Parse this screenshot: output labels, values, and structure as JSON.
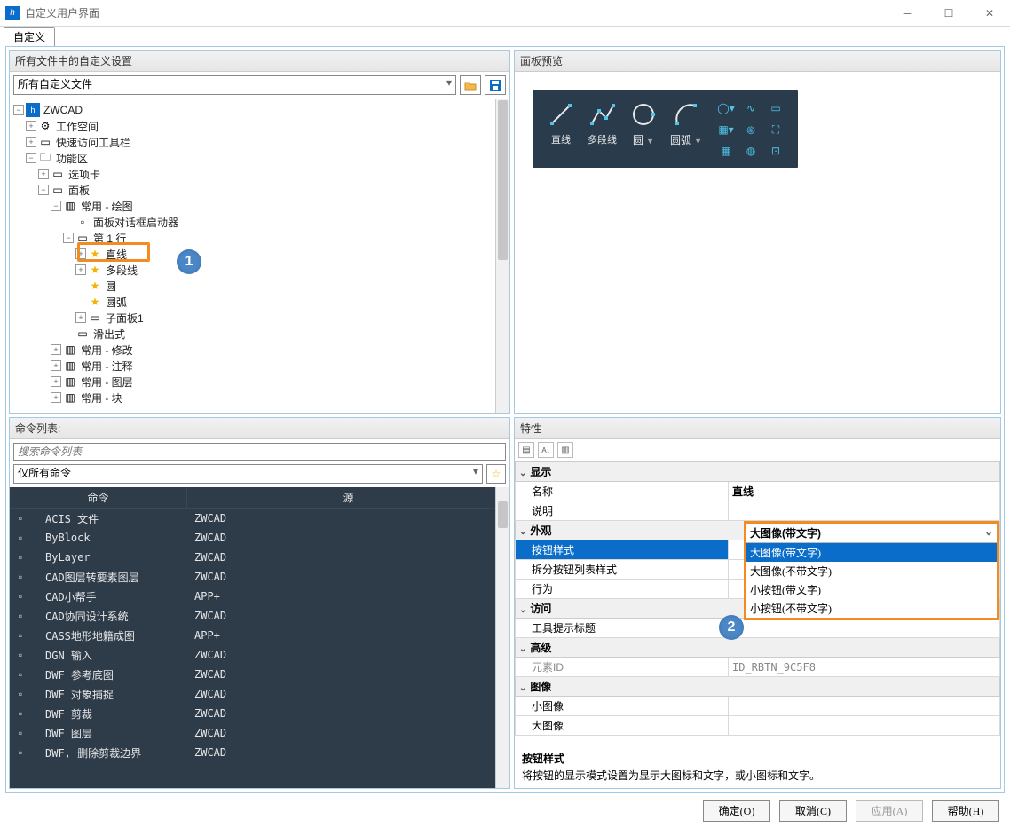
{
  "window": {
    "title": "自定义用户界面"
  },
  "tabstrip": {
    "tab": "自定义"
  },
  "leftTop": {
    "header": "所有文件中的自定义设置",
    "filter": "所有自定义文件",
    "tree": {
      "zwcad": "ZWCAD",
      "workspace": "工作空间",
      "quickAccess": "快速访问工具栏",
      "ribbon": "功能区",
      "tabs": "选项卡",
      "panels": "面板",
      "panel_draw": "常用 - 绘图",
      "dialogLauncher": "面板对话框启动器",
      "row1": "第 1 行",
      "line": "直线",
      "polyline": "多段线",
      "circle": "圆",
      "arc": "圆弧",
      "subpanel1": "子面板1",
      "slideout": "滑出式",
      "panel_modify": "常用 - 修改",
      "panel_annotate": "常用 - 注释",
      "panel_layer": "常用 - 图层",
      "panel_block": "常用 - 块"
    }
  },
  "rightTop": {
    "header": "面板预览",
    "tools": {
      "line": "直线",
      "polyline": "多段线",
      "circle": "圆",
      "arc": "圆弧"
    }
  },
  "leftBottom": {
    "header": "命令列表:",
    "searchPlaceholder": "搜索命令列表",
    "filter": "仅所有命令",
    "cols": {
      "cmd": "命令",
      "src": "源"
    },
    "rows": [
      {
        "cmd": "ACIS 文件",
        "src": "ZWCAD"
      },
      {
        "cmd": "ByBlock",
        "src": "ZWCAD"
      },
      {
        "cmd": "ByLayer",
        "src": "ZWCAD"
      },
      {
        "cmd": "CAD图层转要素图层",
        "src": "ZWCAD"
      },
      {
        "cmd": "CAD小帮手",
        "src": "APP+"
      },
      {
        "cmd": "CAD协同设计系统",
        "src": "ZWCAD"
      },
      {
        "cmd": "CASS地形地籍成图",
        "src": "APP+"
      },
      {
        "cmd": "DGN 输入",
        "src": "ZWCAD"
      },
      {
        "cmd": "DWF 参考底图",
        "src": "ZWCAD"
      },
      {
        "cmd": "DWF 对象捕捉",
        "src": "ZWCAD"
      },
      {
        "cmd": "DWF 剪裁",
        "src": "ZWCAD"
      },
      {
        "cmd": "DWF 图层",
        "src": "ZWCAD"
      },
      {
        "cmd": "DWF, 删除剪裁边界",
        "src": "ZWCAD"
      }
    ]
  },
  "rightBottom": {
    "header": "特性",
    "cats": {
      "display": "显示",
      "appearance": "外观",
      "access": "访问",
      "advanced": "高级",
      "image": "图像"
    },
    "props": {
      "name_k": "名称",
      "name_v": "直线",
      "desc_k": "说明",
      "btnstyle_k": "按钮样式",
      "btnstyle_v": "大图像(带文字)",
      "split_k": "拆分按钮列表样式",
      "behavior_k": "行为",
      "tooltip_k": "工具提示标题",
      "elemid_k": "元素ID",
      "elemid_v": "ID_RBTN_9C5F8",
      "smallimg_k": "小图像",
      "largeimg_k": "大图像"
    },
    "dropdown": {
      "opt1": "大图像(带文字)",
      "opt2": "大图像(不带文字)",
      "opt3": "小按钮(带文字)",
      "opt4": "小按钮(不带文字)"
    },
    "descTitle": "按钮样式",
    "descText": "将按钮的显示模式设置为显示大图标和文字，或小图标和文字。"
  },
  "buttons": {
    "ok": "确定(O)",
    "cancel": "取消(C)",
    "apply": "应用(A)",
    "help": "帮助(H)"
  },
  "callouts": {
    "one": "1",
    "two": "2"
  }
}
